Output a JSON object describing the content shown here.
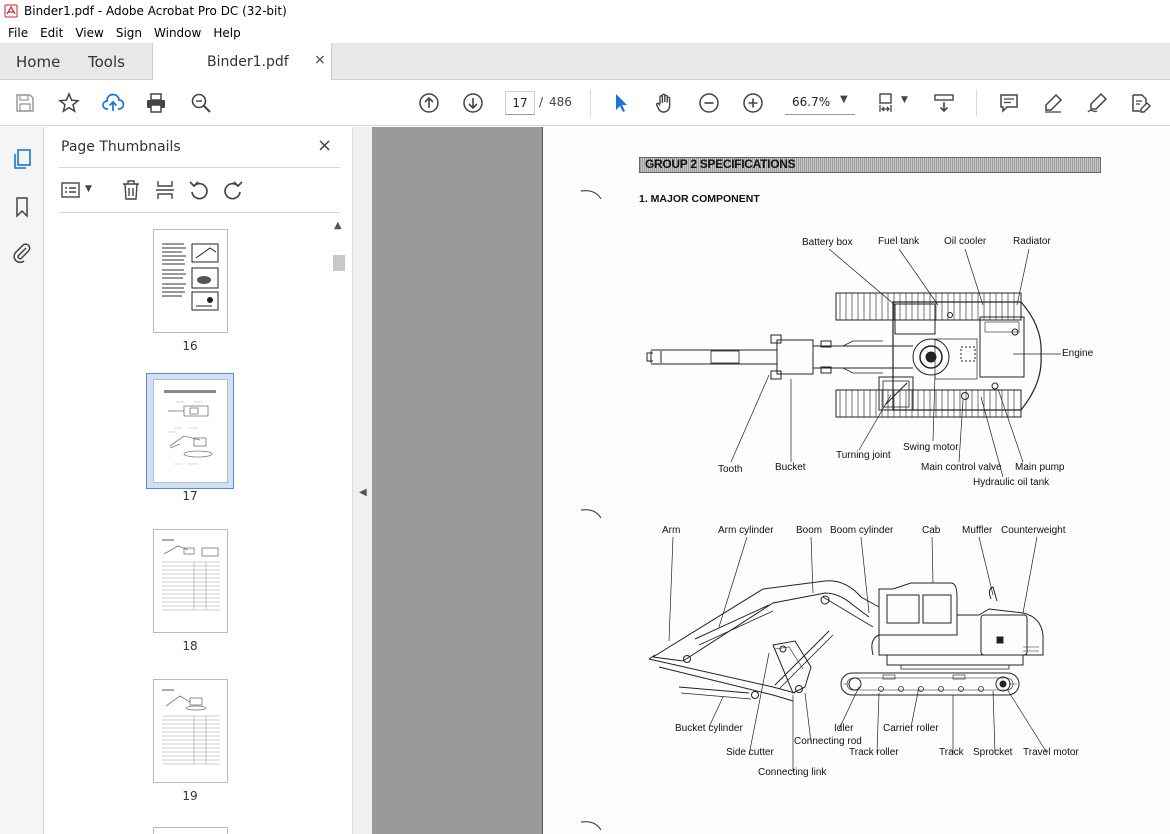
{
  "window": {
    "title": "Binder1.pdf - Adobe Acrobat Pro DC (32-bit)"
  },
  "menu": [
    "File",
    "Edit",
    "View",
    "Sign",
    "Window",
    "Help"
  ],
  "tabs": {
    "home": "Home",
    "tools": "Tools",
    "document": "Binder1.pdf",
    "close": "×"
  },
  "toolbar": {
    "current_page": "17",
    "page_separator": "/",
    "total_pages": "486",
    "zoom": "66.7%"
  },
  "thumbnails_panel": {
    "title": "Page Thumbnails",
    "close": "×",
    "pages": [
      "16",
      "17",
      "18",
      "19"
    ],
    "selected_page": "17"
  },
  "document": {
    "group_title": "GROUP 2 SPECIFICATIONS",
    "section_title": "1. MAJOR COMPONENT",
    "top_view_labels": {
      "battery_box": "Battery box",
      "fuel_tank": "Fuel tank",
      "oil_cooler": "Oil cooler",
      "radiator": "Radiator",
      "engine": "Engine",
      "tooth": "Tooth",
      "bucket": "Bucket",
      "turning_joint": "Turning joint",
      "swing_motor": "Swing motor",
      "main_control_valve": "Main control valve",
      "main_pump": "Main pump",
      "hydraulic_oil_tank": "Hydraulic oil tank"
    },
    "side_view_labels": {
      "arm": "Arm",
      "arm_cylinder": "Arm cylinder",
      "boom": "Boom",
      "boom_cylinder": "Boom cylinder",
      "cab": "Cab",
      "muffler": "Muffler",
      "counterweight": "Counterweight",
      "bucket_cylinder": "Bucket cylinder",
      "side_cutter": "Side cutter",
      "connecting_link": "Connecting link",
      "connecting_rod": "Connecting rod",
      "idler": "Idler",
      "track_roller": "Track roller",
      "carrier_roller": "Carrier roller",
      "track": "Track",
      "sprocket": "Sprocket",
      "travel_motor": "Travel motor"
    }
  },
  "icons": {
    "save": "save-icon",
    "bookmark": "star-icon",
    "upload": "cloud-upload-icon",
    "print": "print-icon",
    "find": "search-zoom-icon",
    "prev": "arrow-up-circle-icon",
    "next": "arrow-down-circle-icon",
    "select": "cursor-arrow-icon",
    "hand": "hand-icon",
    "zoom_out": "zoom-out-icon",
    "zoom_in": "zoom-in-icon",
    "fit": "fit-page-icon",
    "scroll": "scroll-mode-icon",
    "comment": "comment-icon",
    "highlight": "highlight-pen-icon",
    "sign": "sign-pen-icon",
    "share": "share-edit-icon"
  }
}
